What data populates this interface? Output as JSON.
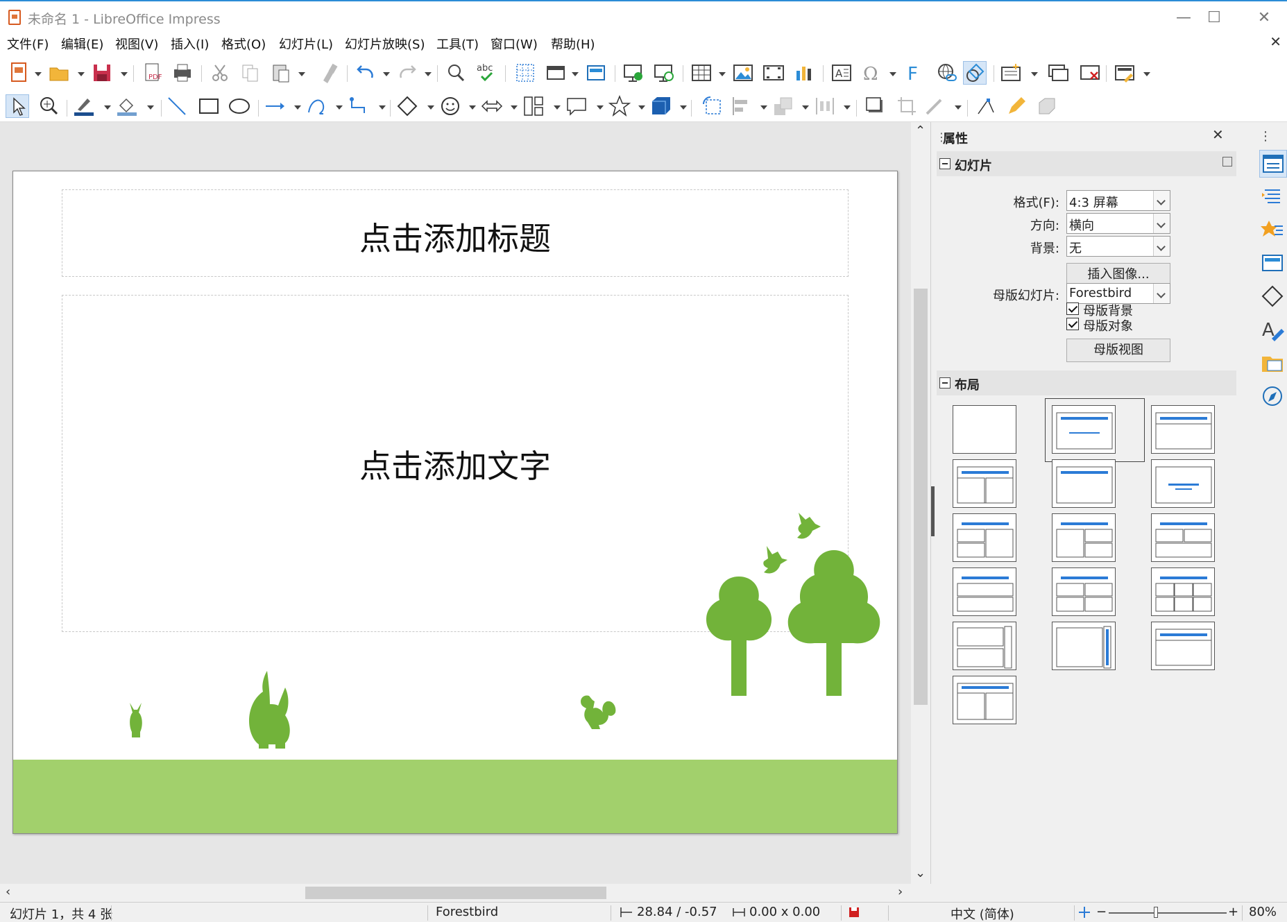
{
  "window": {
    "title": "未命名 1 - LibreOffice Impress",
    "minimize": "—",
    "maximize": "☐",
    "close": "✕"
  },
  "menu": [
    "文件(F)",
    "编辑(E)",
    "视图(V)",
    "插入(I)",
    "格式(O)",
    "幻灯片(L)",
    "幻灯片放映(S)",
    "工具(T)",
    "窗口(W)",
    "帮助(H)"
  ],
  "menu_close": "✕",
  "slide": {
    "title_placeholder": "点击添加标题",
    "content_placeholder": "点击添加文字"
  },
  "sidebar": {
    "title": "属性",
    "close": "✕",
    "menu": "⋮",
    "slide_section": {
      "label": "幻灯片",
      "format_label": "格式(F):",
      "format_value": "4:3 屏幕",
      "orientation_label": "方向:",
      "orientation_value": "横向",
      "background_label": "背景:",
      "background_value": "无",
      "insert_image": "插入图像...",
      "master_label": "母版幻灯片:",
      "master_value": "Forestbird",
      "master_background": "母版背景",
      "master_objects": "母版对象",
      "master_view": "母版视图"
    },
    "layout_section": {
      "label": "布局"
    }
  },
  "status": {
    "slide_info": "幻灯片 1，共 4 张",
    "master": "Forestbird",
    "position": "28.84 / -0.57",
    "size": "0.00 x 0.00",
    "language": "中文 (简体)",
    "zoom": "80%"
  },
  "colors": {
    "accent": "#2b8cd6",
    "grass": "#a2d06c",
    "nature_green": "#72b33a"
  }
}
